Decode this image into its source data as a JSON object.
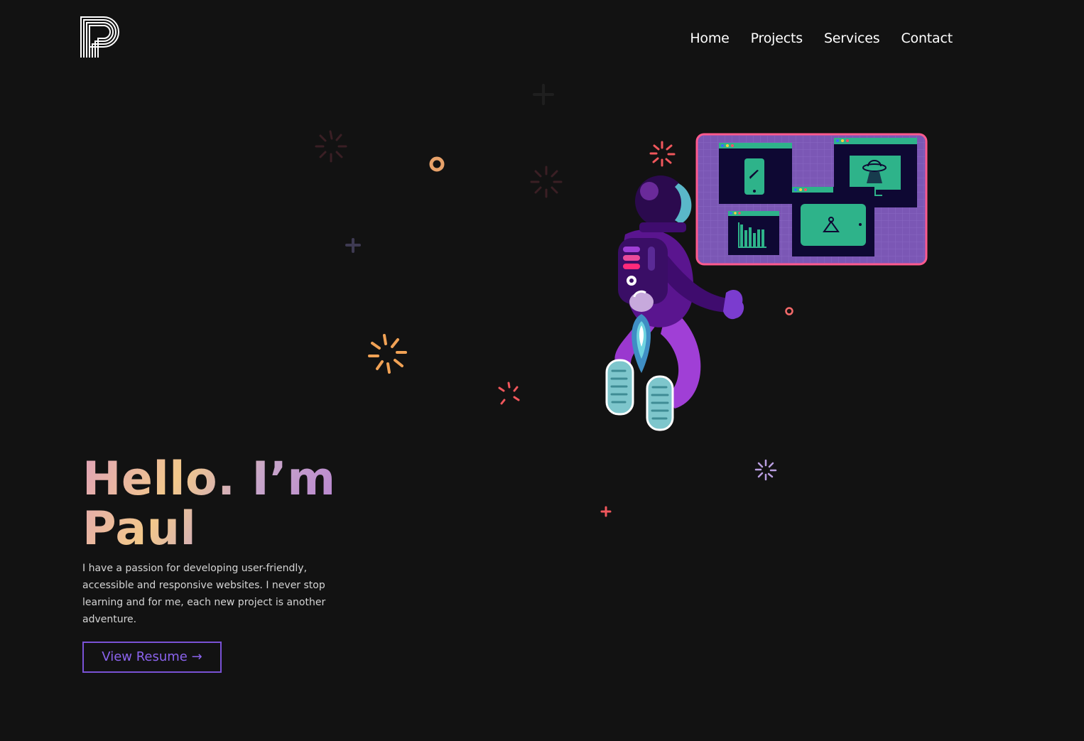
{
  "header": {
    "logo_icon": "stylized-p-logo",
    "nav": [
      {
        "label": "Home"
      },
      {
        "label": "Projects"
      },
      {
        "label": "Services"
      },
      {
        "label": "Contact"
      }
    ]
  },
  "hero": {
    "headline_line1": "Hello. I’m",
    "headline_line2": "Paul",
    "intro": "I have a passion for developing user-friendly, accessible and responsive websites. I never stop learning and for me, each new project is another adventure.",
    "resume_button": "View Resume →",
    "illustration": "astronaut-with-screens"
  },
  "colors": {
    "background": "#121212",
    "accent": "#7a52d6",
    "panel": "#7b57b5",
    "panel_border": "#ff5a8e",
    "screen_green": "#2eb38a"
  }
}
